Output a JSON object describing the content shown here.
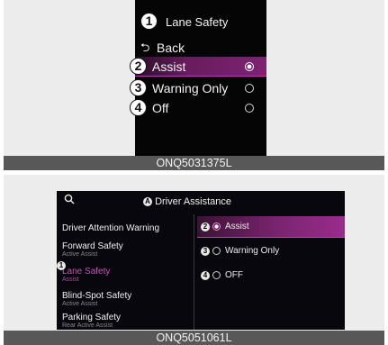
{
  "figure1": {
    "title": "Lane Safety",
    "title_callout": "1",
    "back_label": "Back",
    "back_arrow": "⮌",
    "options": [
      {
        "callout": "2",
        "label": "Assist",
        "selected": true
      },
      {
        "callout": "3",
        "label": "Warning Only",
        "selected": false
      },
      {
        "callout": "4",
        "label": "Off",
        "selected": false
      }
    ],
    "caption": "ONQ5031375L"
  },
  "figure2": {
    "search_icon": "search-icon",
    "header_callout": "A",
    "header_title": "Driver Assistance",
    "menu": [
      {
        "label": "Driver Attention Warning",
        "sub": ""
      },
      {
        "label": "Forward Safety",
        "sub": "Active Assist"
      },
      {
        "label": "Lane Safety",
        "sub": "Assist",
        "callout": "1",
        "active": true
      },
      {
        "label": "Blind-Spot Safety",
        "sub": "Active Assist"
      },
      {
        "label": "Parking Safety",
        "sub": "Rear Active Assist"
      }
    ],
    "options": [
      {
        "callout": "2",
        "label": "Assist",
        "selected": true
      },
      {
        "callout": "3",
        "label": "Warning Only",
        "selected": false
      },
      {
        "callout": "4",
        "label": "OFF",
        "selected": false
      }
    ],
    "caption": "ONQ5051061L"
  },
  "colors": {
    "accent": "#7d2272",
    "accent_line": "#c43ab4",
    "screen_bg": "#050505",
    "caption_bg": "#585858"
  }
}
